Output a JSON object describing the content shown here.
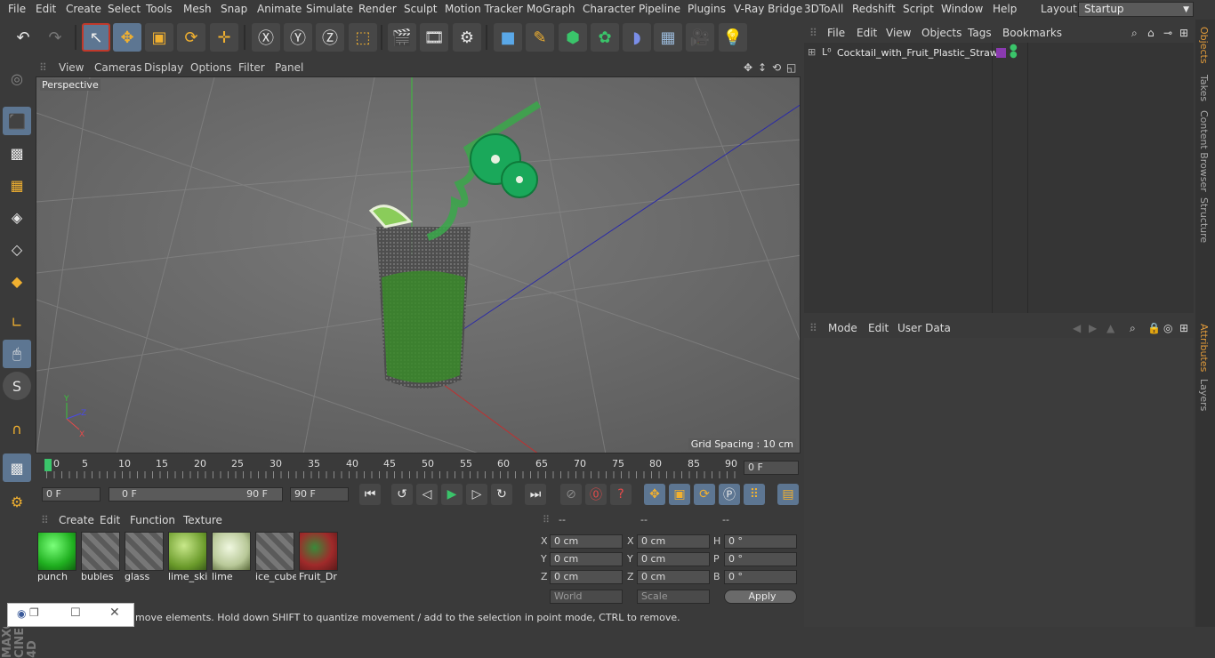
{
  "menubar": {
    "items": [
      "File",
      "Edit",
      "Create",
      "Select",
      "Tools",
      "Mesh",
      "Snap",
      "Animate",
      "Simulate",
      "Render",
      "Sculpt",
      "Motion Tracker",
      "MoGraph",
      "Character",
      "Pipeline",
      "Plugins",
      "V-Ray Bridge",
      "3DToAll",
      "Redshift",
      "Script",
      "Window",
      "Help"
    ],
    "layout_label": "Layout:",
    "layout_value": "Startup"
  },
  "toolbar": {
    "icons": [
      "undo-icon",
      "redo-icon",
      "select-icon",
      "move-icon",
      "scale-icon",
      "rotate-icon",
      "transform-icon",
      "x-axis-icon",
      "y-axis-icon",
      "z-axis-icon",
      "coord-system-icon",
      "render-view-icon",
      "render-picture-icon",
      "render-settings-icon",
      "cube-icon",
      "pen-icon",
      "subdivision-icon",
      "cloner-icon",
      "deformer-icon",
      "floor-icon",
      "camera-icon",
      "light-icon"
    ]
  },
  "viewport": {
    "menu": [
      "View",
      "Cameras",
      "Display",
      "Options",
      "Filter",
      "Panel"
    ],
    "label": "Perspective",
    "grid_spacing": "Grid Spacing : 10 cm"
  },
  "timeline": {
    "ticks": [
      "0",
      "5",
      "10",
      "15",
      "20",
      "25",
      "30",
      "35",
      "40",
      "45",
      "50",
      "55",
      "60",
      "65",
      "70",
      "75",
      "80",
      "85",
      "90"
    ],
    "current_frame": "0 F"
  },
  "transport": {
    "start_field": "0 F",
    "range_start": "0 F",
    "range_end": "90 F",
    "end_field": "90 F"
  },
  "materials": {
    "menu": [
      "Create",
      "Edit",
      "Function",
      "Texture"
    ],
    "items": [
      {
        "name": "punch",
        "color": "#2fd02f"
      },
      {
        "name": "bubles",
        "color": "striped"
      },
      {
        "name": "glass",
        "color": "striped"
      },
      {
        "name": "lime_ski",
        "color": "#8dbf3a"
      },
      {
        "name": "lime",
        "color": "#d8e6b8"
      },
      {
        "name": "ice_cube",
        "color": "striped"
      },
      {
        "name": "Fruit_Dr",
        "color": "#b0302a"
      }
    ]
  },
  "coordinates": {
    "header": [
      "--",
      "--",
      "--"
    ],
    "rows": [
      {
        "a": "X",
        "av": "0 cm",
        "b": "X",
        "bv": "0 cm",
        "c": "H",
        "cv": "0 °"
      },
      {
        "a": "Y",
        "av": "0 cm",
        "b": "Y",
        "bv": "0 cm",
        "c": "P",
        "cv": "0 °"
      },
      {
        "a": "Z",
        "av": "0 cm",
        "b": "Z",
        "bv": "0 cm",
        "c": "B",
        "cv": "0 °"
      }
    ],
    "world": "World",
    "scale": "Scale",
    "apply": "Apply"
  },
  "status": {
    "text": "move elements. Hold down SHIFT to quantize movement / add to the selection in point mode, CTRL to remove."
  },
  "objects": {
    "menu": [
      "File",
      "Edit",
      "View",
      "Objects",
      "Tags",
      "Bookmarks"
    ],
    "items": [
      {
        "name": "Cocktail_with_Fruit_Plastic_Straw",
        "layer_color": "#8a3ab0"
      }
    ]
  },
  "attributes": {
    "menu": [
      "Mode",
      "Edit",
      "User Data"
    ]
  },
  "side_tabs": [
    "Objects",
    "Takes",
    "Content Browser",
    "Structure",
    "Attributes",
    "Layers"
  ]
}
